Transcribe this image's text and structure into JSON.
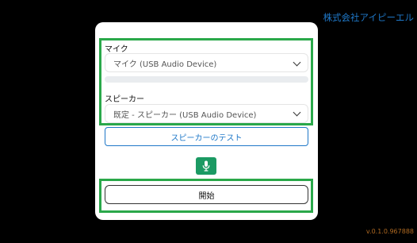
{
  "brand": "株式会社アイピーエル",
  "version": "v.0.1.0.967888",
  "mic": {
    "label": "マイク",
    "selected": "マイク (USB Audio Device)"
  },
  "speaker": {
    "label": "スピーカー",
    "selected": "既定 - スピーカー (USB Audio Device)",
    "test_button": "スピーカーのテスト"
  },
  "start_button": "開始",
  "colors": {
    "background": "#000000",
    "brand": "#1f78c8",
    "highlight": "#2aa84a",
    "mic_button": "#1b9a63",
    "version": "#b06a22"
  },
  "icons": {
    "mic_button": "microphone-icon",
    "select_caret": "chevron-down-icon"
  }
}
